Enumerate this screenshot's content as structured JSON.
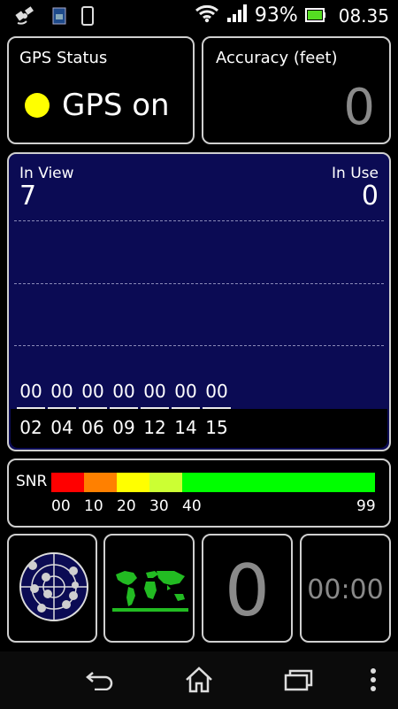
{
  "status_bar": {
    "battery_percent": "93%",
    "time": "08.35",
    "icons": [
      "gps-notification-icon",
      "sim-card-icon",
      "phone-icon",
      "wifi-icon",
      "signal-icon",
      "battery-icon"
    ]
  },
  "gps_status": {
    "label": "GPS Status",
    "value": "GPS on",
    "indicator_color": "#ffff00"
  },
  "accuracy": {
    "label": "Accuracy (feet)",
    "value": "0"
  },
  "satellites": {
    "in_view_label": "In View",
    "in_view_value": "7",
    "in_use_label": "In Use",
    "in_use_value": "0",
    "snr_values": [
      "00",
      "00",
      "00",
      "00",
      "00",
      "00",
      "00"
    ],
    "prns": [
      "02",
      "04",
      "06",
      "09",
      "12",
      "14",
      "15"
    ]
  },
  "snr_legend": {
    "label": "SNR",
    "ticks": [
      "00",
      "10",
      "20",
      "30",
      "40",
      "99"
    ],
    "colors": [
      "#ff0000",
      "#ff8000",
      "#ffff00",
      "#ccff33",
      "#00ff00"
    ]
  },
  "tiles": {
    "sats_used": "0",
    "timer": "00:00"
  },
  "nav": {
    "icons": [
      "back-icon",
      "home-icon",
      "recent-apps-icon",
      "menu-icon"
    ]
  }
}
